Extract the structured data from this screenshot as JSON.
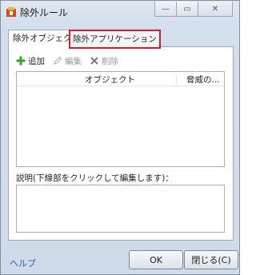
{
  "window": {
    "title": "除外ルール"
  },
  "titlebar_buttons": {
    "minimize": "—",
    "maximize": "▭",
    "close": "✕"
  },
  "tabs": [
    {
      "label": "除外オブジェクト",
      "active": true
    },
    {
      "label": "除外アプリケーション",
      "active": false,
      "highlighted": true
    }
  ],
  "toolbar": {
    "add_label": "追加",
    "edit_label": "編集",
    "delete_label": "削除"
  },
  "list": {
    "columns": [
      "オブジェクト",
      "脅威の..."
    ],
    "rows": []
  },
  "description": {
    "label": "説明(下線部をクリックして編集します)："
  },
  "footer": {
    "help_label": "ヘルプ",
    "ok_label": "OK",
    "close_label": "閉じる(C)"
  },
  "colors": {
    "highlight": "#e0182b",
    "add_icon": "#2ea52e",
    "link": "#2d5fa8"
  }
}
